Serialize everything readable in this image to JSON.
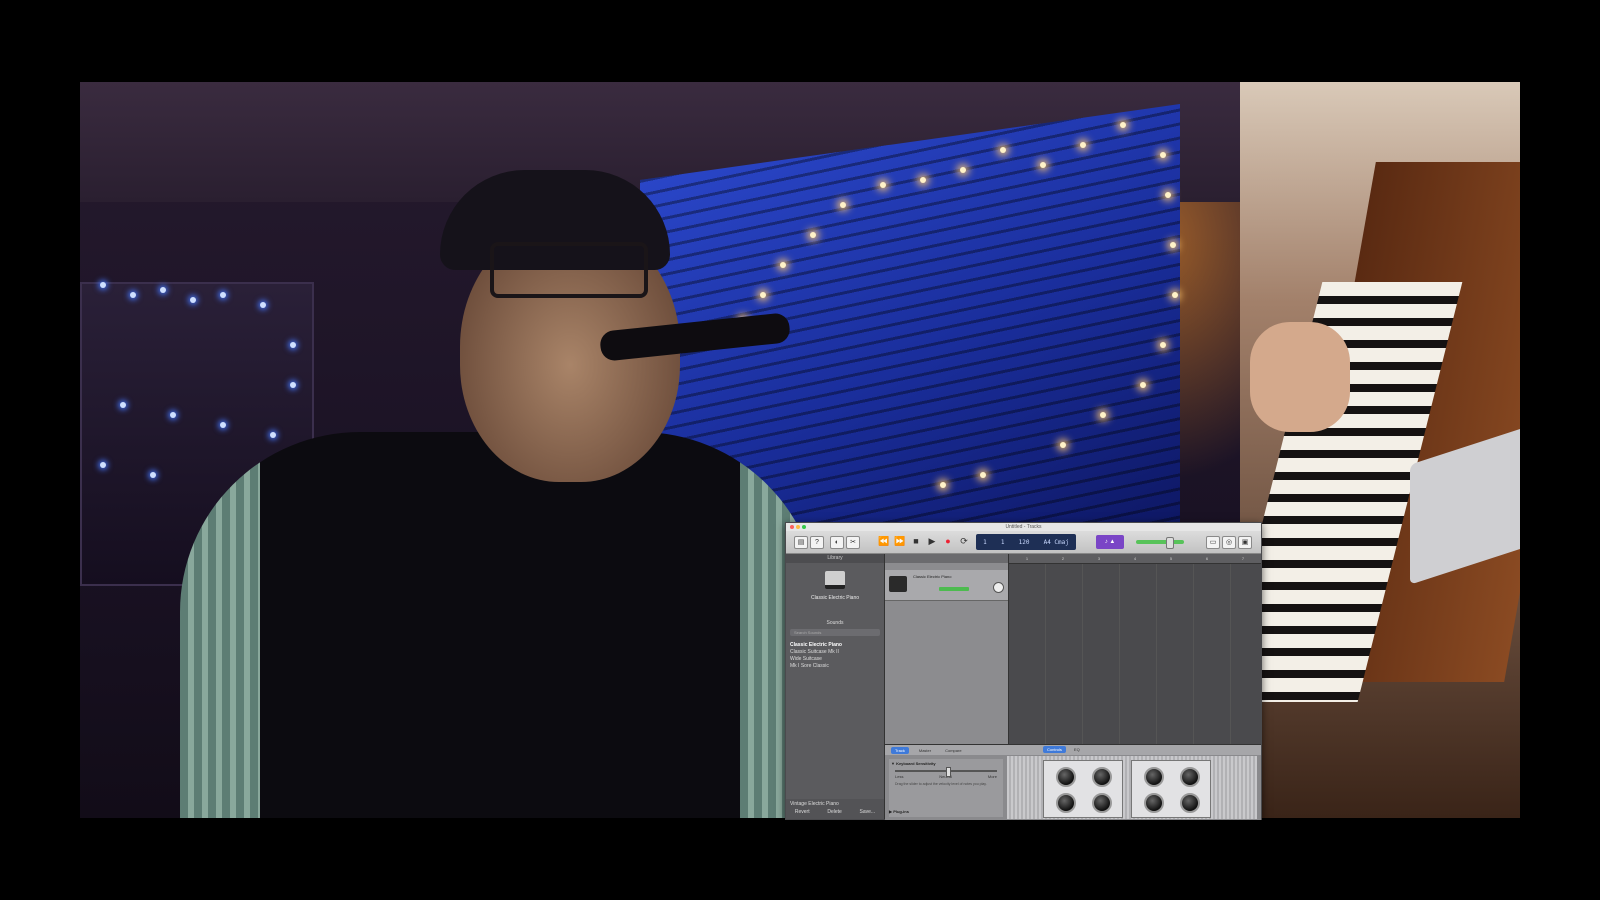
{
  "video": {
    "scene": "webcam feed of musician in room with string lights and piano overlay"
  },
  "garageband": {
    "title": "Untitled - Tracks",
    "toolbar": {
      "lcd_bar": "1",
      "lcd_beat": "1",
      "lcd_tempo": "120",
      "lcd_key": "A4 Cmaj"
    },
    "library": {
      "header": "Library",
      "patch_name": "Classic Electric Piano",
      "sounds_label": "Sounds",
      "search_placeholder": "Search Sounds",
      "items": [
        "Classic Electric Piano",
        "Classic Suitcase Mk II",
        "Wide Suitcase",
        "Mk I Sore Classic"
      ],
      "footer_name": "Vintage Electric Piano",
      "footer_buttons": [
        "Revert",
        "Delete",
        "Save..."
      ]
    },
    "track": {
      "name": "Classic Electric Piano"
    },
    "ruler": [
      "1",
      "2",
      "3",
      "4",
      "5",
      "6",
      "7"
    ],
    "editor": {
      "tabs": [
        "Track",
        "Master",
        "Compare"
      ],
      "right_tabs": [
        "Controls",
        "EQ"
      ],
      "settings_title": "▼ Keyboard Sensitivity",
      "settings_labels": [
        "Less",
        "Neutral",
        "More"
      ],
      "settings_desc": "Drag the slider to adjust the velocity level of notes you play.",
      "plugins_label": "▶ Plug-ins"
    }
  },
  "colors": {
    "accent": "#3f7ad9",
    "purple": "#7a45c6",
    "meter": "#4dbb4f"
  }
}
